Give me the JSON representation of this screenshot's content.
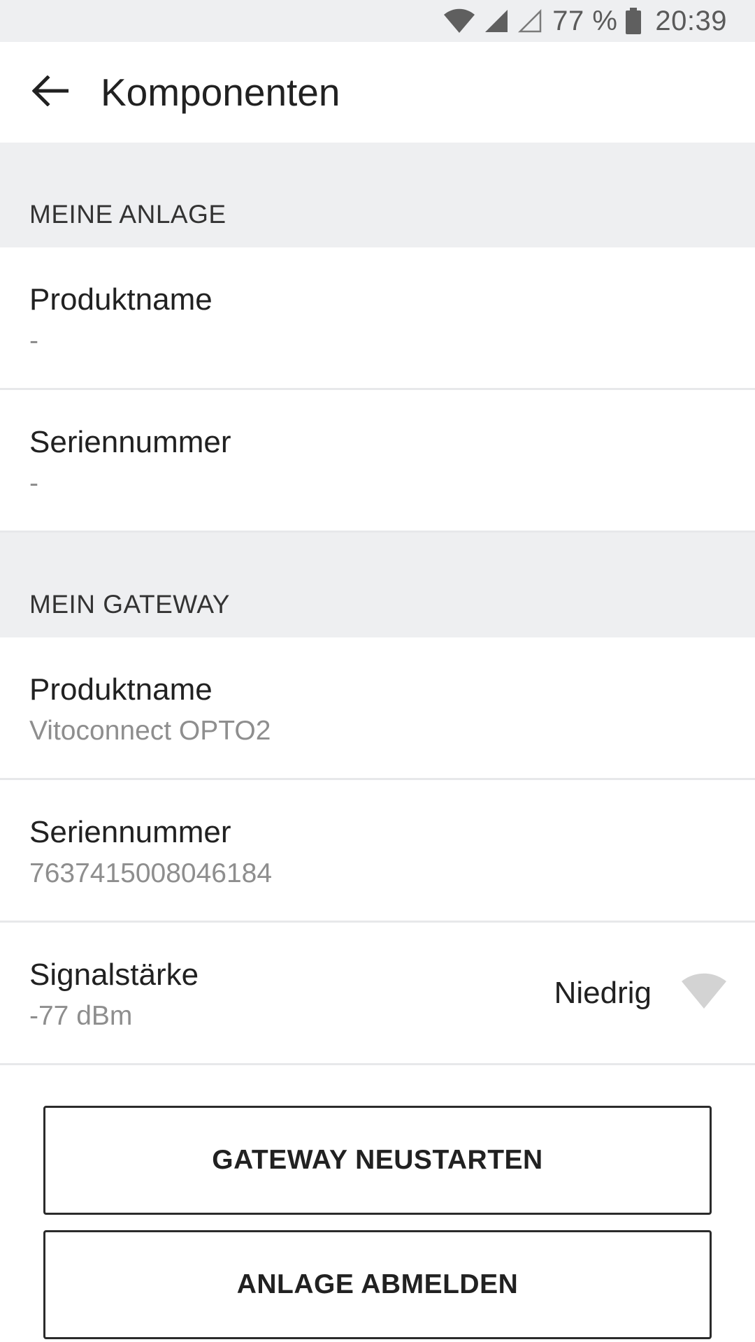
{
  "status_bar": {
    "battery_text": "77 %",
    "time": "20:39",
    "icons": [
      "wifi-icon",
      "cell-signal-icon",
      "cell-signal-empty-icon",
      "battery-icon"
    ]
  },
  "app_bar": {
    "title": "Komponenten",
    "back_icon": "arrow-back-icon"
  },
  "sections": [
    {
      "header": "MEINE ANLAGE",
      "rows": [
        {
          "label": "Produktname",
          "value": "-"
        },
        {
          "label": "Seriennummer",
          "value": "-"
        }
      ]
    },
    {
      "header": "MEIN GATEWAY",
      "rows": [
        {
          "label": "Produktname",
          "value": "Vitoconnect OPTO2"
        },
        {
          "label": "Seriennummer",
          "value": "7637415008046184"
        },
        {
          "label": "Signalstärke",
          "value": "-77 dBm",
          "status": "Niedrig",
          "status_icon": "wifi-signal-icon"
        }
      ]
    }
  ],
  "buttons": {
    "restart_gateway": "GATEWAY NEUSTARTEN",
    "unregister_system": "ANLAGE ABMELDEN"
  },
  "colors": {
    "section_background": "#eeeff1",
    "divider": "#e7e8ea",
    "secondary_text": "#8e8e8e",
    "signal_icon": "#d3d3d3"
  }
}
